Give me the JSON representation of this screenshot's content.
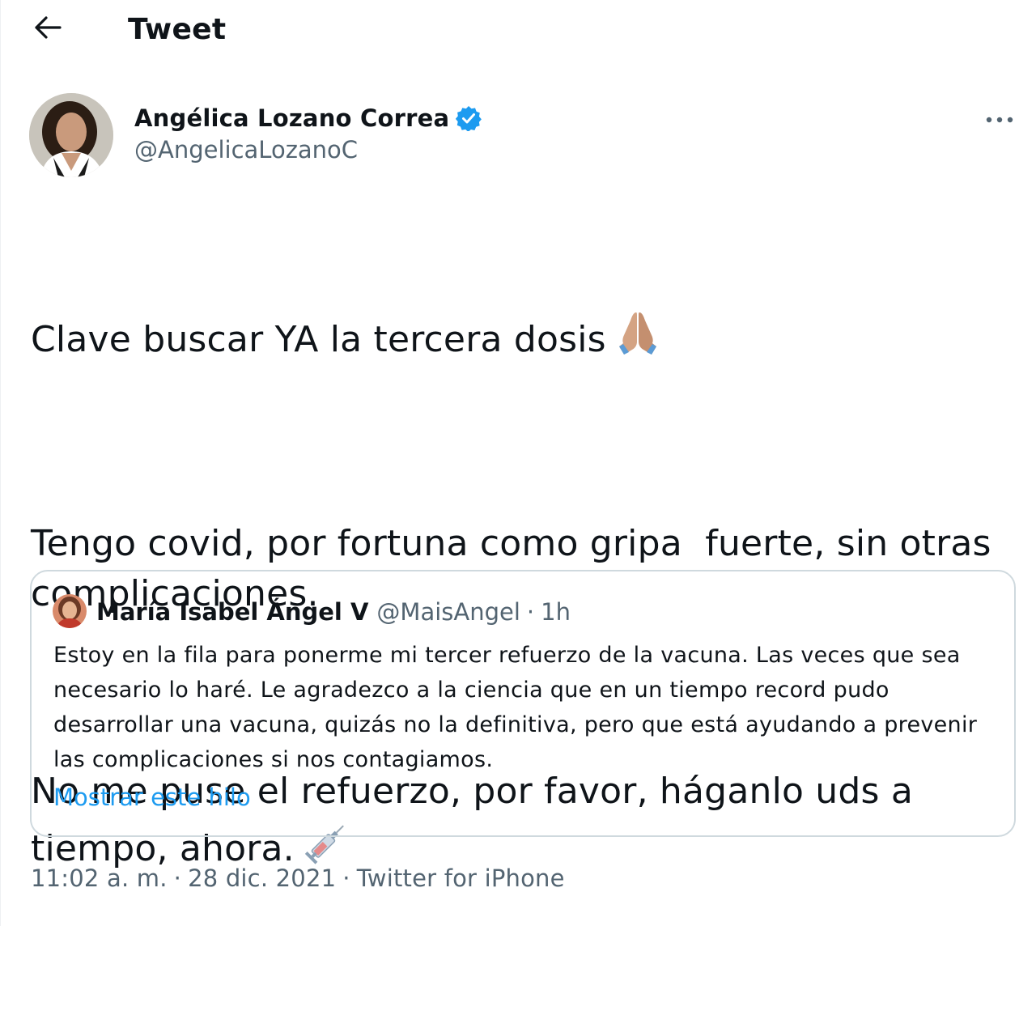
{
  "header": {
    "title": "Tweet"
  },
  "author": {
    "name": "Angélica Lozano Correa",
    "handle": "@AngelicaLozanoC",
    "verified": true
  },
  "tweet": {
    "paragraphs": [
      "Clave buscar YA la tercera dosis",
      "Tengo covid, por fortuna como gripa  fuerte, sin otras complicaciones.",
      "No me puse el refuerzo, por favor, háganlo uds a tiempo, ahora."
    ],
    "emojis": [
      "folded-hands-icon",
      "syringe-icon"
    ]
  },
  "quoted_tweet": {
    "name": "María Isabel Ángel V",
    "handle": "@MaisAngel",
    "separator": "·",
    "time": "1h",
    "text": "Estoy en la fila para ponerme mi tercer refuerzo de la vacuna. Las veces que sea necesario lo haré. Le agradezco a la ciencia que en un tiempo record pudo desarrollar una vacuna, quizás no la definitiva, pero que está ayudando a prevenir las complicaciones si nos contagiamos.",
    "thread_link": "Mostrar este hilo"
  },
  "meta": {
    "time": "11:02 a. m.",
    "separator": "·",
    "date": "28 dic. 2021",
    "source": "Twitter for iPhone"
  },
  "colors": {
    "accent": "#1d9bf0",
    "secondary_text": "#536471",
    "border": "#cfd9de"
  }
}
